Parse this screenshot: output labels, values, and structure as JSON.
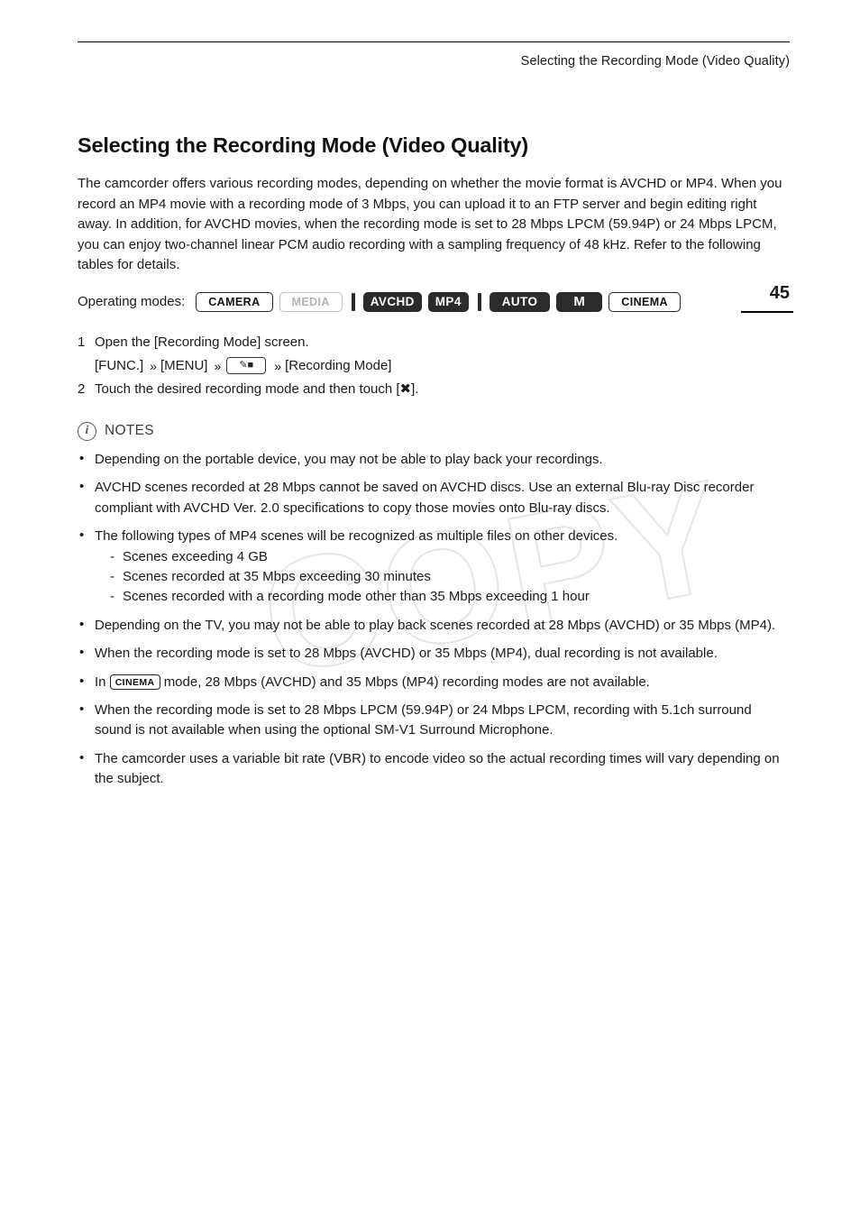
{
  "header": {
    "running_title": "Selecting the Recording Mode (Video Quality)",
    "page_number": "45"
  },
  "main": {
    "title": "Selecting the Recording Mode (Video Quality)",
    "intro": "The camcorder offers various recording modes, depending on whether the movie format is AVCHD or MP4. When you record an MP4 movie with a recording mode of 3 Mbps, you can upload it to an FTP server and begin editing right away. In addition, for AVCHD movies, when the recording mode is set to 28 Mbps LPCM (59.94P) or 24 Mbps LPCM, you can enjoy two-channel linear PCM audio recording with a sampling frequency of 48 kHz. Refer to the following tables for details."
  },
  "operating_modes": {
    "label": "Operating modes:",
    "badges": [
      {
        "text": "CAMERA",
        "style": "outline"
      },
      {
        "text": "MEDIA",
        "style": "dim"
      },
      {
        "text": "AVCHD",
        "style": "solid"
      },
      {
        "text": "MP4",
        "style": "solid"
      },
      {
        "text": "AUTO",
        "style": "solid"
      },
      {
        "text": "M",
        "style": "solid"
      },
      {
        "text": "CINEMA",
        "style": "outline"
      }
    ]
  },
  "steps": [
    {
      "num": "1",
      "text": "Open the [Recording Mode] screen."
    },
    {
      "num": "2",
      "text": "Touch the desired recording mode and then touch [✖]."
    }
  ],
  "path": {
    "first": "[FUNC.]",
    "second": "[MENU]",
    "icon_name": "recording-setup-icon",
    "last": "[Recording Mode]",
    "arrow": "»"
  },
  "notes": {
    "heading": "NOTES",
    "items": [
      {
        "text": "Depending on the portable device, you may not be able to play back your recordings."
      },
      {
        "text": "AVCHD scenes recorded at 28 Mbps cannot be saved on AVCHD discs. Use an external Blu-ray Disc recorder compliant with AVCHD Ver. 2.0 specifications to copy those movies onto Blu-ray discs."
      },
      {
        "text": "The following types of MP4 scenes will be recognized as multiple files on other devices.",
        "subitems": [
          "Scenes exceeding 4 GB",
          "Scenes recorded at 35 Mbps exceeding 30 minutes",
          "Scenes recorded with a recording mode other than 35 Mbps exceeding 1 hour"
        ]
      },
      {
        "text": "Depending on the TV, you may not be able to play back scenes recorded at 28 Mbps (AVCHD) or 35 Mbps (MP4)."
      },
      {
        "text": "When the recording mode is set to 28 Mbps (AVCHD) or 35 Mbps (MP4), dual recording is not available."
      },
      {
        "text_before": "In",
        "badge": "CINEMA",
        "text_after": "mode, 28 Mbps (AVCHD) and 35 Mbps (MP4) recording modes are not available."
      },
      {
        "text": "When the recording mode is set to 28 Mbps LPCM (59.94P) or 24 Mbps LPCM, recording with 5.1ch surround sound is not available when using the optional SM-V1 Surround Microphone."
      },
      {
        "text": "The camcorder uses a variable bit rate (VBR) to encode video so the actual recording times will vary depending on the subject."
      }
    ]
  },
  "watermark": {
    "text": "COPY"
  }
}
